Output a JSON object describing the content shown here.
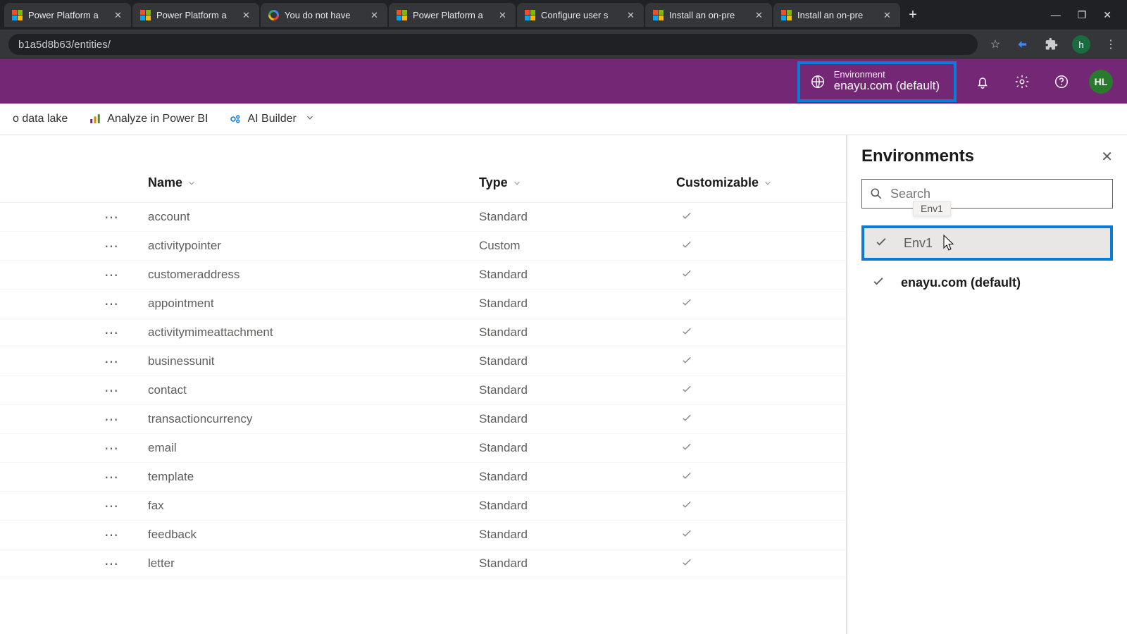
{
  "browser": {
    "tabs": [
      {
        "title": "Power Platform a"
      },
      {
        "title": "Power Platform a"
      },
      {
        "title": "You do not have"
      },
      {
        "title": "Power Platform a"
      },
      {
        "title": "Configure user s"
      },
      {
        "title": "Install an on-pre"
      },
      {
        "title": "Install an on-pre"
      }
    ],
    "url_fragment": "b1a5d8b63/entities/",
    "profile_letter": "h"
  },
  "header": {
    "env_label": "Environment",
    "env_value": "enayu.com (default)",
    "avatar": "HL"
  },
  "toolbar": {
    "datalake": "o data lake",
    "analyze": "Analyze in Power BI",
    "ai": "AI Builder"
  },
  "table": {
    "columns": {
      "name": "Name",
      "type": "Type",
      "custom": "Customizable"
    },
    "rows": [
      {
        "name": "account",
        "type": "Standard",
        "custom": true
      },
      {
        "name": "activitypointer",
        "type": "Custom",
        "custom": true
      },
      {
        "name": "customeraddress",
        "type": "Standard",
        "custom": true
      },
      {
        "name": "appointment",
        "type": "Standard",
        "custom": true
      },
      {
        "name": "activitymimeattachment",
        "type": "Standard",
        "custom": true
      },
      {
        "name": "businessunit",
        "type": "Standard",
        "custom": true
      },
      {
        "name": "contact",
        "type": "Standard",
        "custom": true
      },
      {
        "name": "transactioncurrency",
        "type": "Standard",
        "custom": true
      },
      {
        "name": "email",
        "type": "Standard",
        "custom": true
      },
      {
        "name": "template",
        "type": "Standard",
        "custom": true
      },
      {
        "name": "fax",
        "type": "Standard",
        "custom": true
      },
      {
        "name": "feedback",
        "type": "Standard",
        "custom": true
      },
      {
        "name": "letter",
        "type": "Standard",
        "custom": true
      }
    ]
  },
  "panel": {
    "title": "Environments",
    "search_placeholder": "Search",
    "tooltip": "Env1",
    "items": [
      {
        "name": "Env1",
        "highlight": true
      },
      {
        "name": "enayu.com (default)",
        "default": true
      }
    ]
  }
}
